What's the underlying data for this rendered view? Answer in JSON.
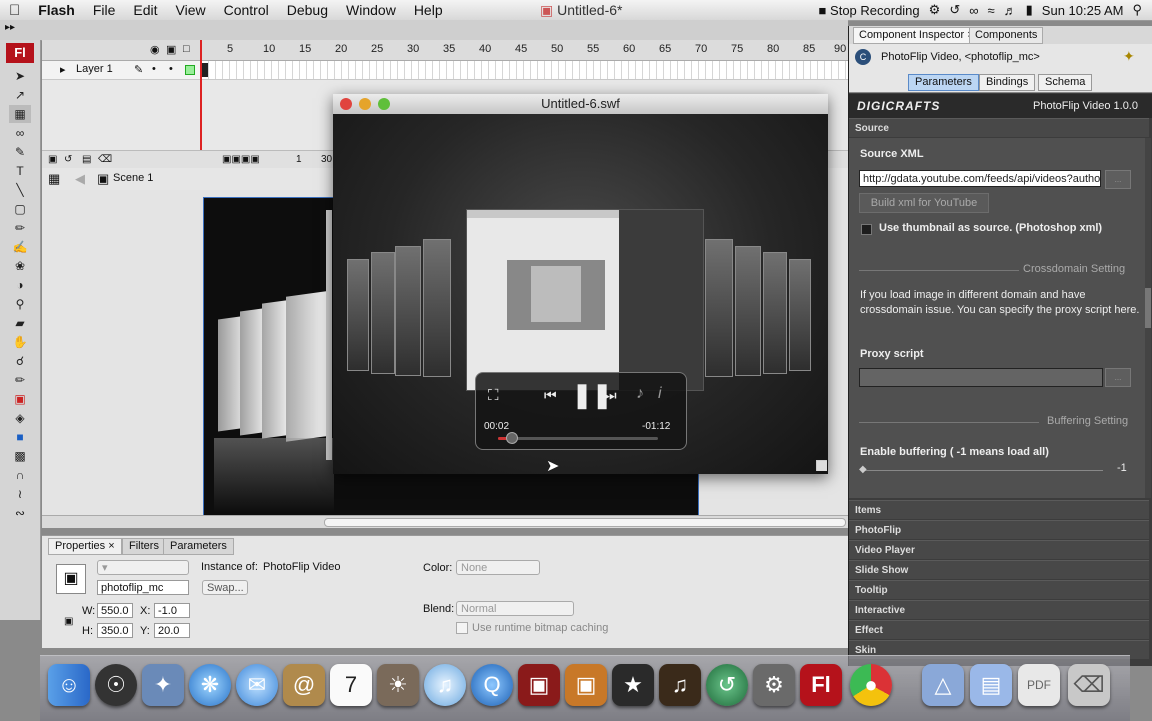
{
  "menubar": {
    "app": "Flash",
    "items": [
      "File",
      "Edit",
      "View",
      "Control",
      "Debug",
      "Window",
      "Help"
    ],
    "document_title": "Untitled-6*",
    "stop_recording": "Stop Recording",
    "clock": "Sun 10:25 AM"
  },
  "timeline": {
    "ticks": [
      "5",
      "10",
      "15",
      "20",
      "25",
      "30",
      "35",
      "40",
      "45",
      "50",
      "55",
      "60",
      "65",
      "70",
      "75",
      "80",
      "85",
      "90"
    ],
    "layer_name": "Layer 1",
    "footer_frame": "1",
    "footer_fps": "30"
  },
  "scene": {
    "label": "Scene 1"
  },
  "swf_window": {
    "title": "Untitled-6.swf",
    "time_elapsed": "00:02",
    "time_remaining": "-01:12",
    "progress": 0.08
  },
  "properties": {
    "tabs": [
      "Properties",
      "Filters",
      "Parameters"
    ],
    "instance_name": "photoflip_mc",
    "instance_of_label": "Instance of:",
    "instance_of_value": "PhotoFlip Video",
    "swap_label": "Swap...",
    "w_label": "W:",
    "w_value": "550.0",
    "h_label": "H:",
    "h_value": "350.0",
    "x_label": "X:",
    "x_value": "-1.0",
    "y_label": "Y:",
    "y_value": "20.0",
    "color_label": "Color:",
    "color_value": "None",
    "blend_label": "Blend:",
    "blend_value": "Normal",
    "cache_label": "Use runtime bitmap caching"
  },
  "inspector": {
    "tabs": [
      "Component Inspector",
      "Components"
    ],
    "component_title": "PhotoFlip Video, <photoflip_mc>",
    "subtabs": [
      "Parameters",
      "Bindings",
      "Schema"
    ],
    "brand": "DIGICRAFTS",
    "brand_product": "PhotoFlip Video 1.0.0",
    "source_header": "Source",
    "source_xml_label": "Source XML",
    "source_xml_value": "http://gdata.youtube.com/feeds/api/videos?author",
    "build_button": "Build xml for YouTube",
    "thumb_label": "Use thumbnail as source. (Photoshop xml)",
    "crossdomain_header": "Crossdomain Setting",
    "crossdomain_text": "If you load image in different domain and have crossdomain issue. You can specify the proxy script here.",
    "proxy_label": "Proxy script",
    "buffering_header": "Buffering Setting",
    "buffering_label": "Enable buffering ( -1 means load all)",
    "buffering_value": "-1",
    "sections": [
      "Items",
      "PhotoFlip",
      "Video Player",
      "Slide Show",
      "Tooltip",
      "Interactive",
      "Effect",
      "Skin"
    ]
  },
  "colors": {
    "accent": "#3a6fbf",
    "playhead": "#dd2222",
    "flash_red": "#b5121b"
  }
}
